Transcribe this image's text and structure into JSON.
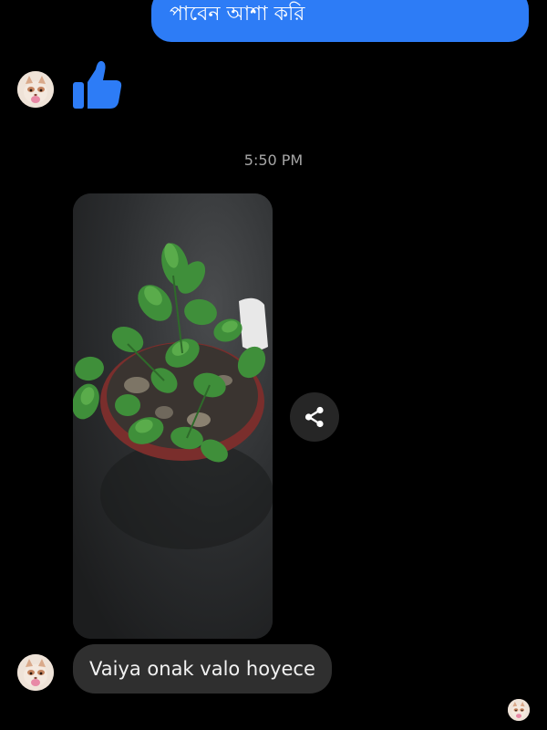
{
  "conversation": {
    "outgoing_message": "পাবেন আশা করি",
    "reaction_icon": "thumbs-up-icon",
    "timestamp": "5:50 PM",
    "shared_photo": {
      "subject": "mint-plant-in-pot"
    },
    "share_icon": "share-icon",
    "incoming_message": "Vaiya onak valo hoyece"
  },
  "colors": {
    "background": "#000000",
    "outgoing_bubble": "#2d7cf6",
    "incoming_bubble": "#2f2f2f",
    "thumb_blue": "#2d7cf6",
    "timestamp": "#a6a6a6",
    "share_button": "#262626"
  }
}
